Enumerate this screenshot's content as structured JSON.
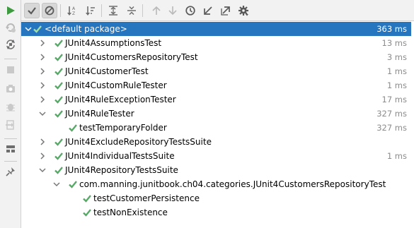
{
  "colors": {
    "accent": "#2675bf",
    "pass": "#59a869",
    "run": "#3e9a3e",
    "muted": "#8c8c8c",
    "icon_disabled": "#b9b9b9",
    "icon": "#6e6e6e"
  },
  "toolbar": {
    "buttons": [
      {
        "name": "show-passed-toggle",
        "icon": "check-icon",
        "pressed": true
      },
      {
        "name": "show-ignored-toggle",
        "icon": "cancel-circle-icon",
        "pressed": true
      },
      {
        "name": "sort-alphabetically-button",
        "icon": "sort-alpha-icon"
      },
      {
        "name": "sort-by-duration-button",
        "icon": "sort-duration-icon"
      },
      {
        "name": "expand-all-button",
        "icon": "expand-all-icon"
      },
      {
        "name": "collapse-all-button",
        "icon": "collapse-all-icon"
      },
      {
        "name": "previous-failed-button",
        "icon": "arrow-up-icon",
        "disabled": true
      },
      {
        "name": "next-failed-button",
        "icon": "arrow-down-icon",
        "disabled": true
      },
      {
        "name": "test-history-button",
        "icon": "history-clock-icon"
      },
      {
        "name": "import-tests-button",
        "icon": "import-arrow-icon"
      },
      {
        "name": "export-tests-button",
        "icon": "export-arrow-icon"
      },
      {
        "name": "settings-button",
        "icon": "gear-icon"
      }
    ]
  },
  "sidebar": {
    "buttons": [
      {
        "name": "rerun-button",
        "icon": "run-play-icon"
      },
      {
        "name": "rerun-failed-button",
        "icon": "rerun-failed-icon",
        "disabled": true
      },
      {
        "name": "toggle-auto-test-button",
        "icon": "auto-test-icon"
      },
      {
        "name": "stop-button",
        "icon": "stop-icon",
        "disabled": true
      },
      {
        "name": "screenshot-button",
        "icon": "camera-icon",
        "disabled": true
      },
      {
        "name": "debug-button",
        "icon": "bug-icon",
        "disabled": true
      },
      {
        "name": "exit-button",
        "icon": "exit-icon",
        "disabled": true
      },
      {
        "name": "layout-button",
        "icon": "layout-icon"
      },
      {
        "name": "pin-button",
        "icon": "pin-icon"
      }
    ]
  },
  "tree": {
    "rows": [
      {
        "label": "<default package>",
        "time": "363 ms",
        "level": 0,
        "arrow": "down",
        "selected": true
      },
      {
        "label": "JUnit4AssumptionsTest",
        "time": "13 ms",
        "level": 1,
        "arrow": "right"
      },
      {
        "label": "JUnit4CustomersRepositoryTest",
        "time": "3 ms",
        "level": 1,
        "arrow": "right"
      },
      {
        "label": "JUnit4CustomerTest",
        "time": "1 ms",
        "level": 1,
        "arrow": "right"
      },
      {
        "label": "JUnit4CustomRuleTester",
        "time": "1 ms",
        "level": 1,
        "arrow": "right"
      },
      {
        "label": "JUnit4RuleExceptionTester",
        "time": "17 ms",
        "level": 1,
        "arrow": "right"
      },
      {
        "label": "JUnit4RuleTester",
        "time": "327 ms",
        "level": 1,
        "arrow": "down"
      },
      {
        "label": "testTemporaryFolder",
        "time": "327 ms",
        "level": 2,
        "arrow": "none"
      },
      {
        "label": "JUnit4ExcludeRepositoryTestsSuite",
        "time": "",
        "level": 1,
        "arrow": "right"
      },
      {
        "label": "JUnit4IndividualTestsSuite",
        "time": "1 ms",
        "level": 1,
        "arrow": "right"
      },
      {
        "label": "JUnit4RepositoryTestsSuite",
        "time": "",
        "level": 1,
        "arrow": "down"
      },
      {
        "label": "com.manning.junitbook.ch04.categories.JUnit4CustomersRepositoryTest",
        "time": "",
        "level": 2,
        "arrow": "down"
      },
      {
        "label": "testCustomerPersistence",
        "time": "",
        "level": 3,
        "arrow": "none"
      },
      {
        "label": "testNonExistence",
        "time": "",
        "level": 3,
        "arrow": "none"
      }
    ]
  }
}
